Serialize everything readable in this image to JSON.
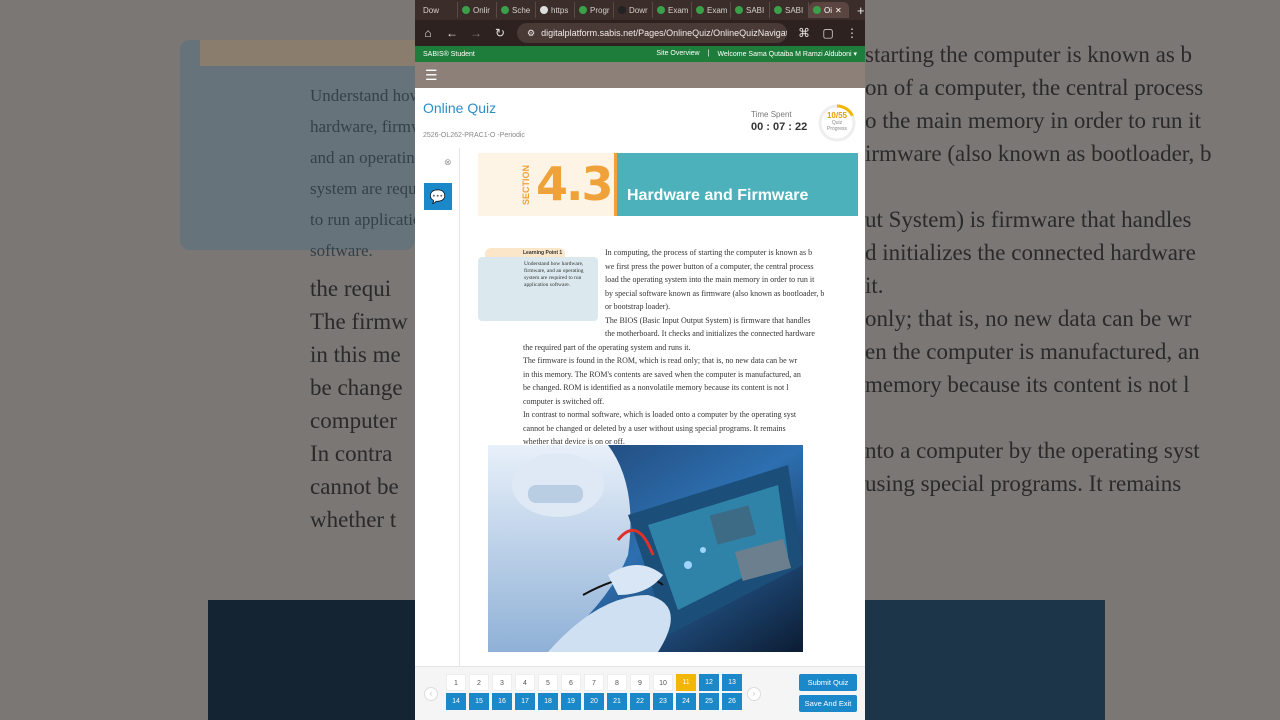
{
  "browser": {
    "tabs": [
      {
        "label": "Dow"
      },
      {
        "label": "Onlir"
      },
      {
        "label": "Sche"
      },
      {
        "label": "https"
      },
      {
        "label": "Progr"
      },
      {
        "label": "Dowr"
      },
      {
        "label": "Exam"
      },
      {
        "label": "Exam"
      },
      {
        "label": "SABI"
      },
      {
        "label": "SABI"
      },
      {
        "label": "Oi"
      }
    ],
    "url": "digitalplatform.sabis.net/Pages/OnlineQuiz/OnlineQuizNavigatic"
  },
  "sabis_bar": {
    "brand": "SABIS® Student",
    "site_overview": "Site Overview",
    "welcome": "Welcome Sama Qutaiba M Ramzi Alduboni ▾"
  },
  "quiz": {
    "title": "Online Quiz",
    "code": "2526-OL262-PRAC1-O -Periodic",
    "time_label": "Time Spent",
    "time_value": "00 : 07 : 22",
    "progress_value": "10/55",
    "progress_label_1": "Quiz",
    "progress_label_2": "Progress",
    "progress_fraction": 0.18
  },
  "banner": {
    "section_word": "SECTION",
    "section_number": "4.3",
    "section_title": "Hardware and Firmware"
  },
  "learning_point": {
    "label": "Learning Point 1",
    "text": "Understand how hardware, firmware, and an operating system are required to run application software."
  },
  "article": {
    "lines": [
      "In computing, the process of starting the computer is known as b",
      "we first press the power button of a computer, the central process",
      "load the operating system into the main memory in order to run it",
      "by special software known as firmware (also known as bootloader, b",
      "or bootstrap loader).",
      "The BIOS (Basic Input Output System) is firmware that handles",
      "the motherboard. It checks and initializes the connected hardware",
      "the required part of the operating system and runs it.",
      "The firmware is found in the ROM, which is read only; that is, no new data can be wr",
      "in this memory. The ROM's contents are saved when the computer is manufactured, an",
      "be changed. ROM is identified as a nonvolatile memory because its content is not l",
      "computer is switched off.",
      "In contrast to normal software, which is loaded onto a computer by the operating syst",
      "cannot be changed or deleted by a user without using special programs. It remains",
      "whether that device is on or off."
    ]
  },
  "navigation": {
    "row1": [
      "1",
      "2",
      "3",
      "4",
      "5",
      "6",
      "7",
      "8",
      "9",
      "10",
      "11",
      "12",
      "13"
    ],
    "row2": [
      "14",
      "15",
      "16",
      "17",
      "18",
      "19",
      "20",
      "21",
      "22",
      "23",
      "24",
      "25",
      "26"
    ],
    "current": "11",
    "submit_label": "Submit Quiz",
    "save_label": "Save And Exit"
  },
  "icons": {
    "home": "home-icon",
    "back": "back-arrow-icon",
    "forward": "forward-arrow-icon",
    "reload": "reload-icon",
    "site_info": "site-info-icon",
    "bookmark": "star-icon",
    "translate": "translate-icon",
    "menu": "hamburger-icon",
    "chat": "chat-icon",
    "close": "close-icon"
  },
  "colors": {
    "accent": "#1b88c9",
    "brand_green": "#1e7d3a",
    "current_question": "#f2b705",
    "banner_teal": "#4db1bb",
    "banner_orange": "#f0a23a"
  }
}
